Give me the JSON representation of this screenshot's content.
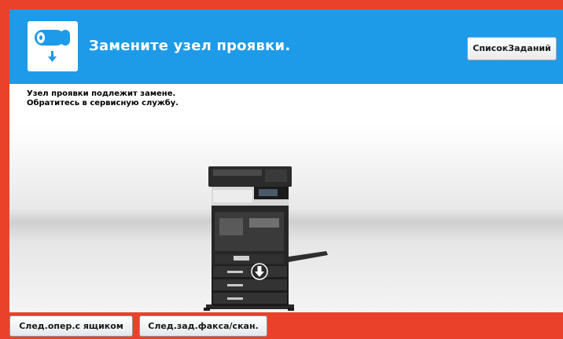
{
  "header": {
    "title": "Замените узел проявки.",
    "icon": "developing-unit-replace-icon",
    "job_list_label": "СписокЗаданий"
  },
  "message": {
    "line1": "Узел проявки подлежит замене.",
    "line2": "Обратитесь в сервисную службу."
  },
  "illustration": {
    "device": "printer-mfp-icon",
    "indicator": "arrow-down-icon"
  },
  "footer": {
    "next_tray_label": "След.опер.с ящиком",
    "next_fax_scan_label": "След.зад.факса/скан."
  },
  "colors": {
    "frame": "#e8432a",
    "header": "#1e9be8",
    "text": "#000000"
  }
}
